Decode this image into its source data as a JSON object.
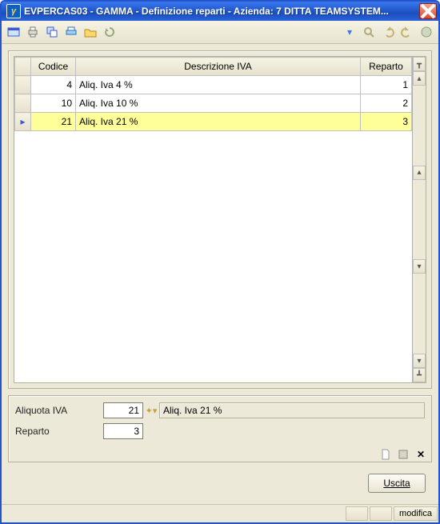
{
  "window": {
    "title": "EVPERCAS03 - GAMMA - Definizione reparti - Azienda:    7 DITTA TEAMSYSTEM...",
    "app_icon_text": "γ"
  },
  "grid": {
    "headers": {
      "indicator": "",
      "codice": "Codice",
      "descrizione": "Descrizione IVA",
      "reparto": "Reparto"
    },
    "rows": [
      {
        "indicator": "",
        "codice": "4",
        "descrizione": "Aliq. Iva  4 %",
        "reparto": "1",
        "selected": false
      },
      {
        "indicator": "",
        "codice": "10",
        "descrizione": "Aliq. Iva 10 %",
        "reparto": "2",
        "selected": false
      },
      {
        "indicator": "▸",
        "codice": "21",
        "descrizione": "Aliq. Iva 21 %",
        "reparto": "3",
        "selected": true
      }
    ]
  },
  "form": {
    "aliquota_label": "Aliquota IVA",
    "aliquota_value": "21",
    "aliquota_display": "Aliq. Iva 21 %",
    "reparto_label": "Reparto",
    "reparto_value": "3"
  },
  "buttons": {
    "uscita": "Uscita"
  },
  "status": {
    "mode": "modifica"
  }
}
